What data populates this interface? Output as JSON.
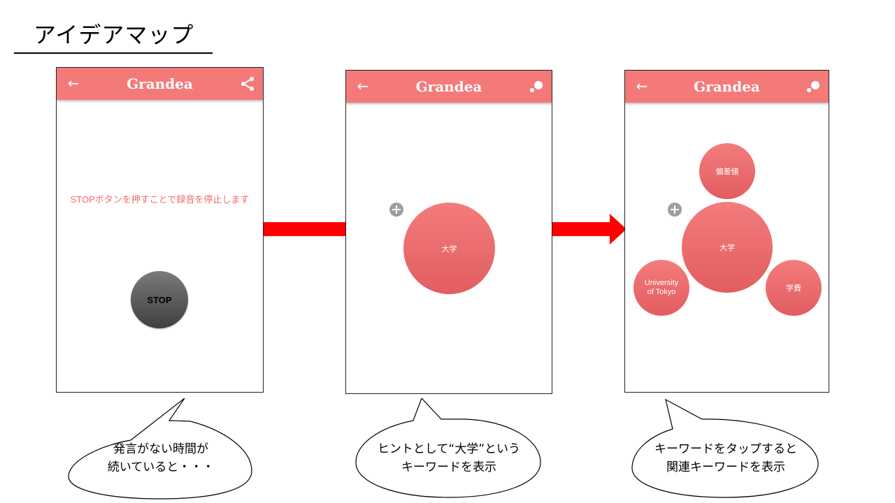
{
  "page_title": "アイデアマップ",
  "app": {
    "brand": "Grandea",
    "accent": "#f47a7a"
  },
  "screen1": {
    "message": "STOPボタンを押すことで録音を停止します",
    "stop_label": "STOP",
    "action_icon": "share-icon"
  },
  "screen2": {
    "center_keyword": "大学",
    "action_icon": "bubbles-icon"
  },
  "screen3": {
    "center_keyword": "大学",
    "related": [
      "偏差値",
      "University of Tokyo",
      "学費"
    ],
    "action_icon": "bubbles-icon"
  },
  "callouts": [
    {
      "line1": "発言がない時間が",
      "line2": "続いていると・・・"
    },
    {
      "line1": "ヒントとして“大学”という",
      "line2": "キーワードを表示"
    },
    {
      "line1": "キーワードをタップすると",
      "line2": "関連キーワードを表示"
    }
  ],
  "colors": {
    "arrow": "#ff0000",
    "node": "#e8676a",
    "stop": "#555555"
  }
}
